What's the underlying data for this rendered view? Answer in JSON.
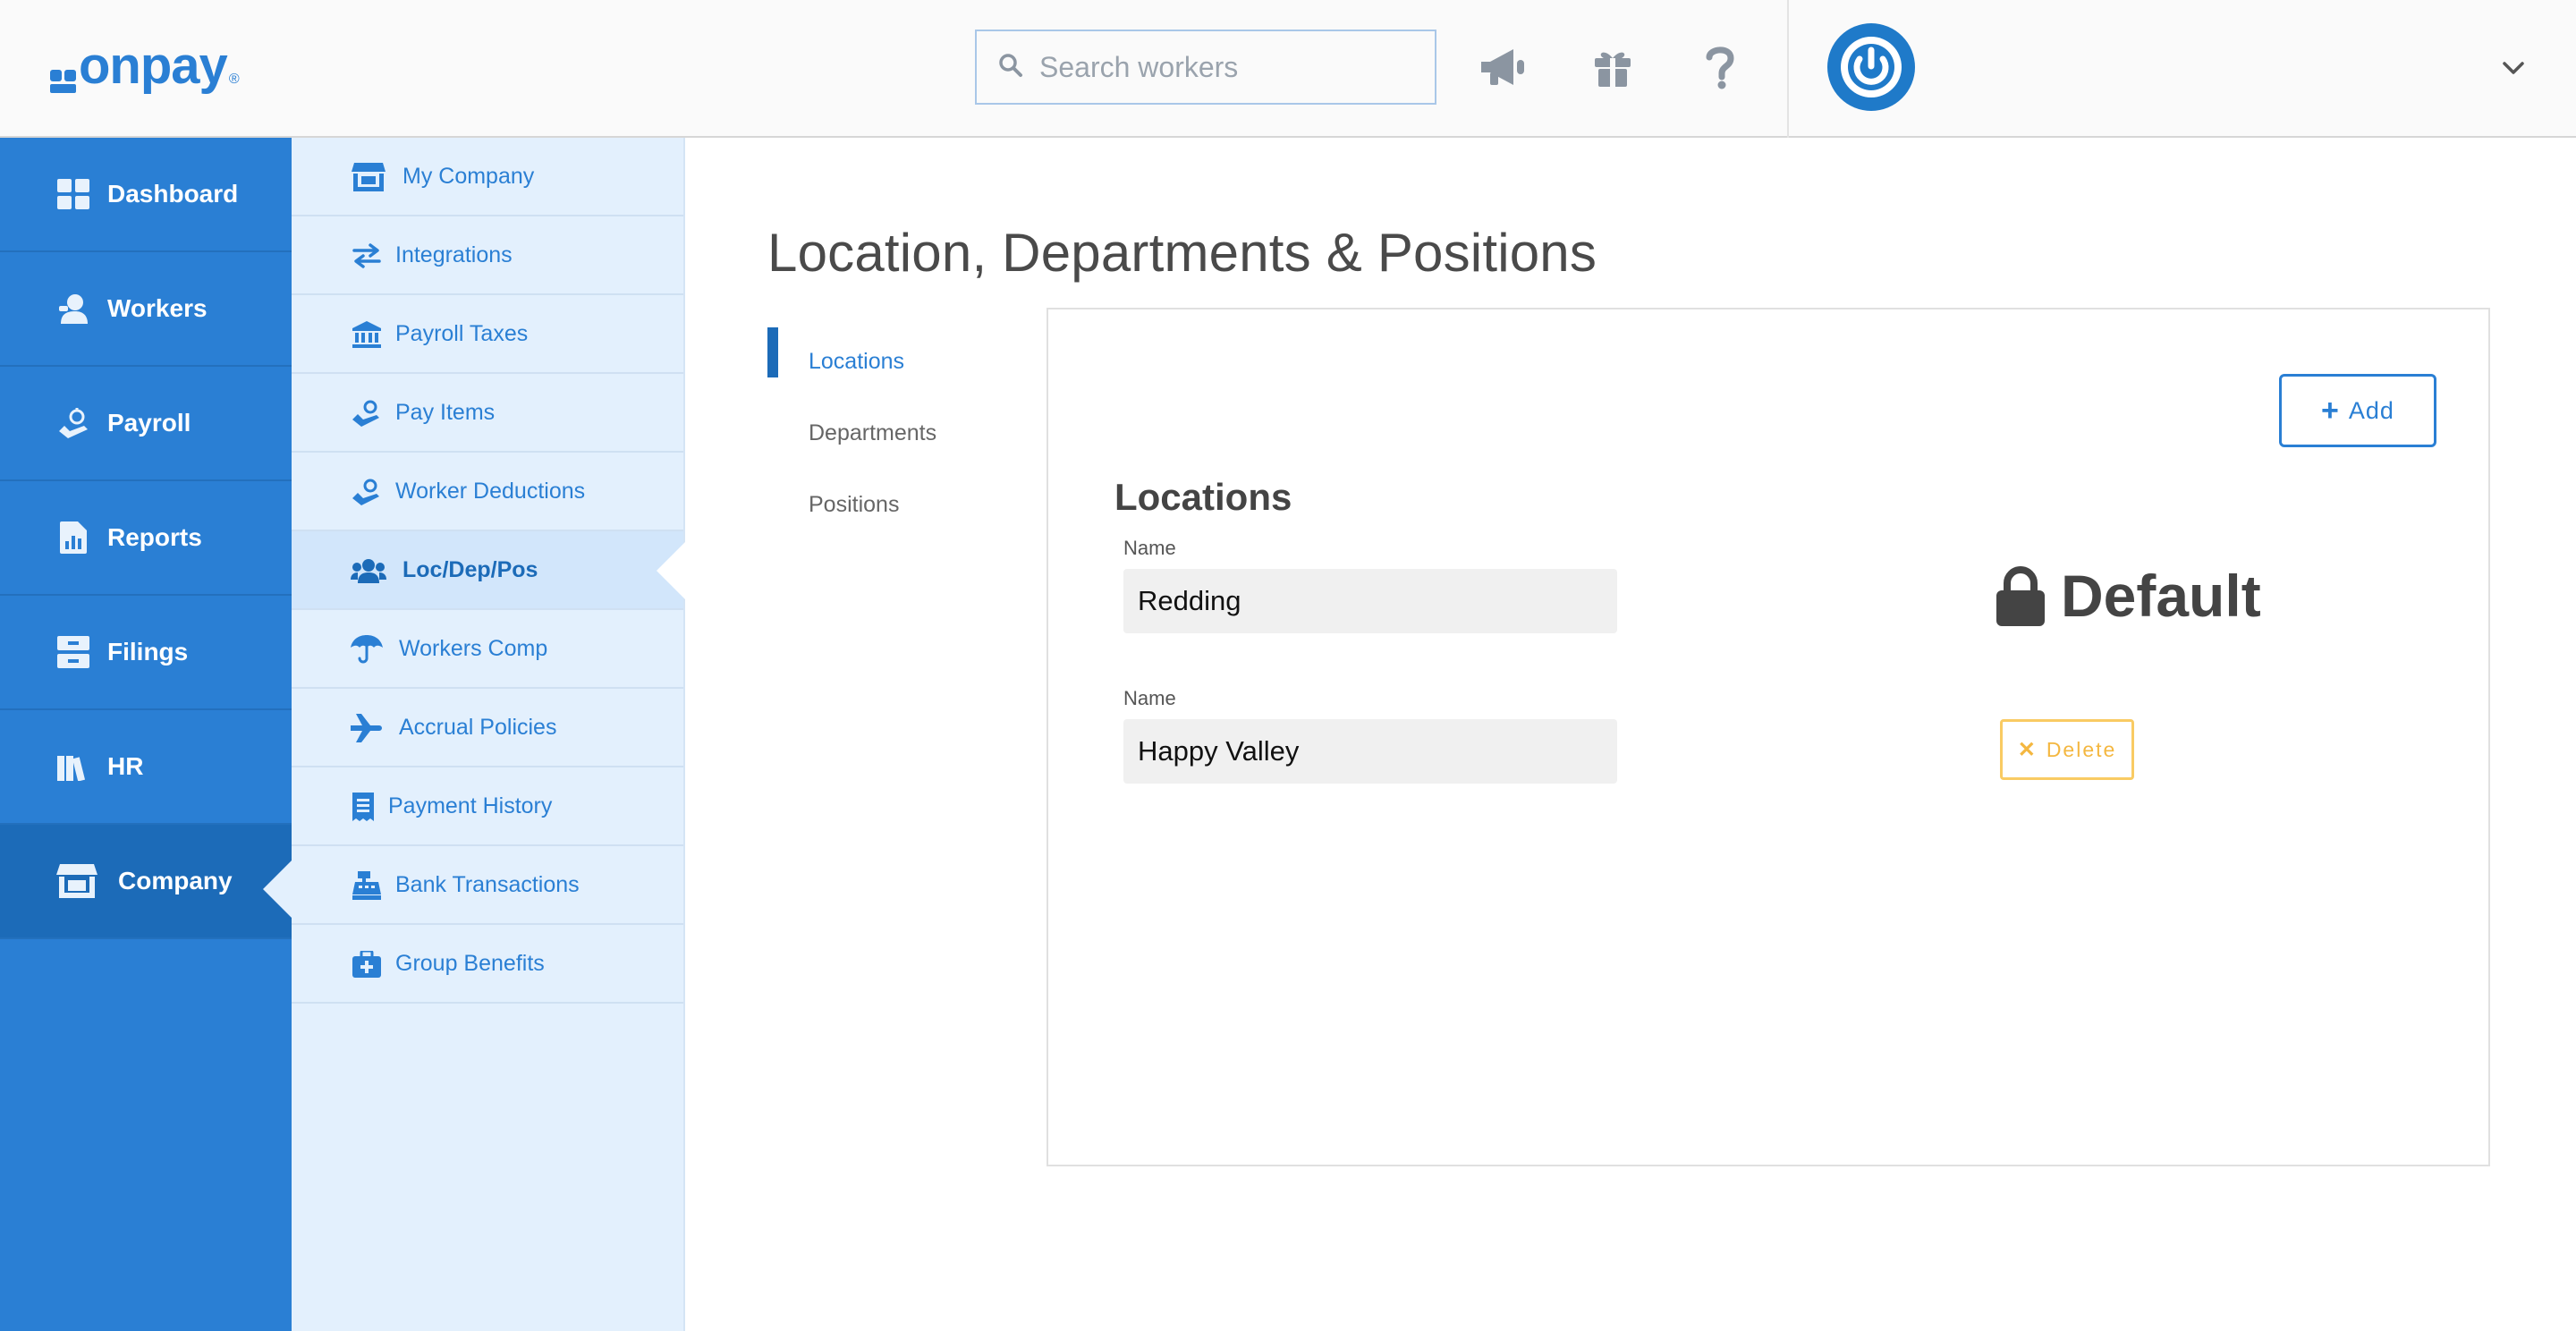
{
  "brand": {
    "name": "onpay",
    "registered_mark": "®",
    "color": "#2a7fd4"
  },
  "header": {
    "search": {
      "placeholder": "Search workers",
      "value": ""
    },
    "icons": [
      "megaphone-icon",
      "gift-icon",
      "help-icon"
    ],
    "user_menu_icon": "chevron-down-icon"
  },
  "primary_nav": {
    "items": [
      {
        "label": "Dashboard",
        "icon": "dashboard-icon"
      },
      {
        "label": "Workers",
        "icon": "workers-icon"
      },
      {
        "label": "Payroll",
        "icon": "payroll-icon"
      },
      {
        "label": "Reports",
        "icon": "reports-icon"
      },
      {
        "label": "Filings",
        "icon": "filings-icon"
      },
      {
        "label": "HR",
        "icon": "hr-icon"
      },
      {
        "label": "Company",
        "icon": "company-icon",
        "active": true
      }
    ]
  },
  "company_nav": {
    "items": [
      {
        "label": "My Company",
        "icon": "storefront-icon"
      },
      {
        "label": "Integrations",
        "icon": "exchange-arrows-icon"
      },
      {
        "label": "Payroll Taxes",
        "icon": "bank-icon"
      },
      {
        "label": "Pay Items",
        "icon": "money-hand-icon"
      },
      {
        "label": "Worker Deductions",
        "icon": "money-hand-icon"
      },
      {
        "label": "Loc/Dep/Pos",
        "icon": "users-icon",
        "active": true
      },
      {
        "label": "Workers Comp",
        "icon": "umbrella-icon"
      },
      {
        "label": "Accrual Policies",
        "icon": "airplane-icon"
      },
      {
        "label": "Payment History",
        "icon": "receipt-icon"
      },
      {
        "label": "Bank Transactions",
        "icon": "cash-register-icon"
      },
      {
        "label": "Group Benefits",
        "icon": "medkit-icon"
      }
    ]
  },
  "page": {
    "title": "Location, Departments & Positions",
    "tabs": [
      {
        "label": "Locations",
        "active": true
      },
      {
        "label": "Departments"
      },
      {
        "label": "Positions"
      }
    ]
  },
  "locations": {
    "add_label": "Add",
    "section_title": "Locations",
    "rows": [
      {
        "field_label": "Name",
        "value": "Redding",
        "status": "Default"
      },
      {
        "field_label": "Name",
        "value": "Happy Valley",
        "action": "Delete"
      }
    ]
  },
  "colors": {
    "primary_nav_bg": "#2a7fd4",
    "secondary_nav_bg": "#e3f0fd",
    "accent": "#1c6bb8",
    "delete": "#f4b740"
  }
}
